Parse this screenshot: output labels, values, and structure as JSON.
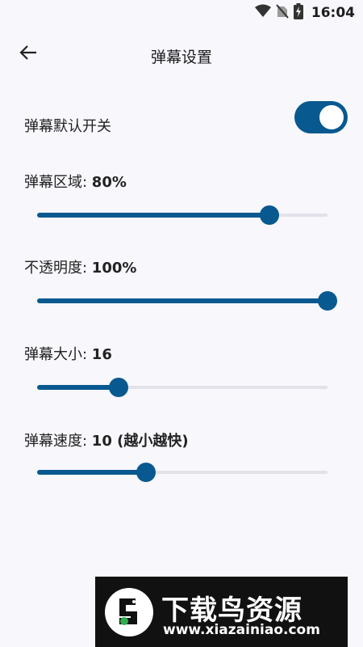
{
  "status_bar": {
    "time": "16:04",
    "icons": [
      "wifi-icon",
      "no-sim-icon",
      "battery-charging-icon"
    ]
  },
  "header": {
    "title": "弹幕设置",
    "back_icon": "arrow-left-icon"
  },
  "settings": {
    "toggle": {
      "label": "弹幕默认开关",
      "on": true
    },
    "area": {
      "label": "弹幕区域: ",
      "value": "80%",
      "level": 0.8
    },
    "opacity": {
      "label": "不透明度: ",
      "value": "100%",
      "level": 1.0
    },
    "size": {
      "label": "弹幕大小: ",
      "value": "16",
      "level": 0.28
    },
    "speed": {
      "label": "弹幕速度: ",
      "value": "10 (越小越快)",
      "level": 0.375
    }
  },
  "colors": {
    "accent": "#08598f",
    "track": "#e2e3ea",
    "background": "#f7f7fc"
  },
  "watermark": {
    "brand": "下载鸟资源",
    "url": "www.xiazainiao.com"
  }
}
